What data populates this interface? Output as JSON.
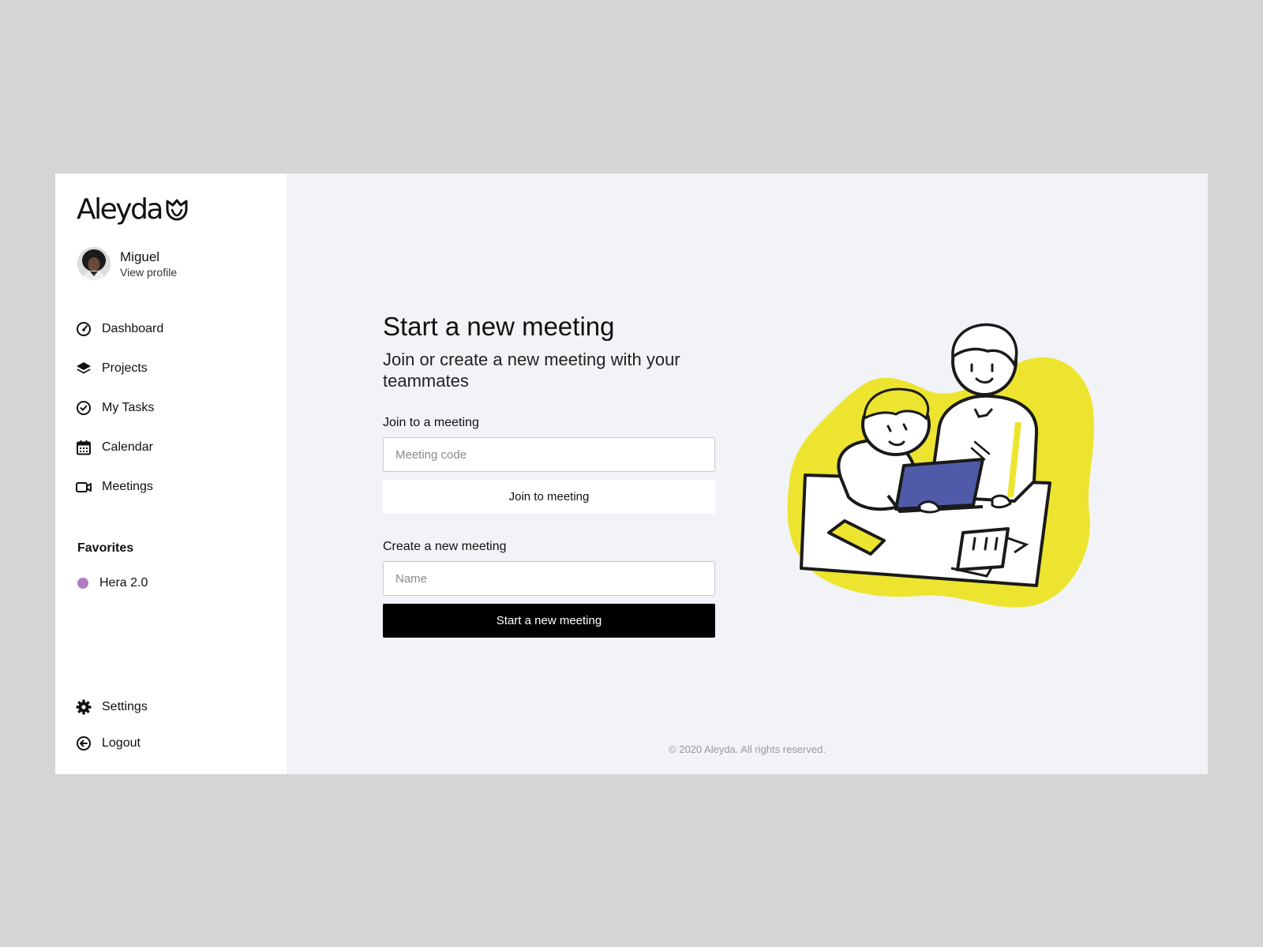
{
  "brand": {
    "name": "Aleyda",
    "logo_icon": "tulip-icon"
  },
  "user": {
    "name": "Miguel",
    "profile_link": "View profile"
  },
  "nav": [
    {
      "label": "Dashboard",
      "icon": "gauge-icon"
    },
    {
      "label": "Projects",
      "icon": "layers-icon"
    },
    {
      "label": "My Tasks",
      "icon": "check-circle-icon"
    },
    {
      "label": "Calendar",
      "icon": "calendar-icon"
    },
    {
      "label": "Meetings",
      "icon": "video-camera-icon"
    }
  ],
  "favorites": {
    "title": "Favorites",
    "items": [
      {
        "label": "Hera 2.0",
        "color": "#b27cc6"
      }
    ]
  },
  "bottom_nav": [
    {
      "label": "Settings",
      "icon": "gear-icon"
    },
    {
      "label": "Logout",
      "icon": "logout-icon"
    }
  ],
  "main": {
    "title": "Start a new meeting",
    "subtitle": "Join or create a new meeting with your teammates",
    "join": {
      "label": "Join to a meeting",
      "placeholder": "Meeting code",
      "value": "",
      "button": "Join to meeting"
    },
    "create": {
      "label": "Create a new meeting",
      "placeholder": "Name",
      "value": "",
      "button": "Start a new meeting"
    }
  },
  "footer": "© 2020 Aleyda. All rights reserved.",
  "colors": {
    "background": "#d5d5d5",
    "main_bg": "#f2f3f6",
    "accent_yellow": "#ede42f",
    "accent_blue": "#4f5ba8",
    "favorite_dot": "#b27cc6",
    "primary_button": "#000000"
  }
}
